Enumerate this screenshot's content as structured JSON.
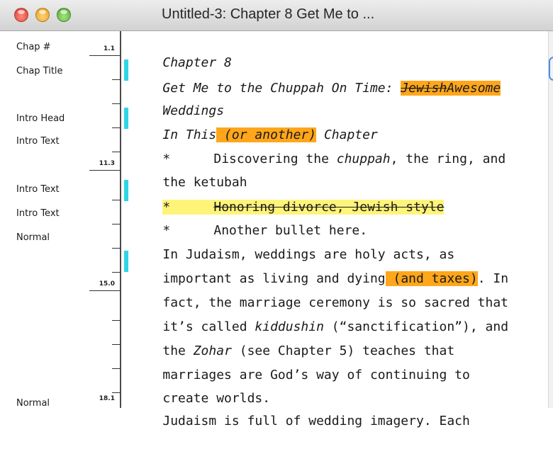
{
  "window": {
    "title": "Untitled-3: Chapter 8 Get Me to ..."
  },
  "sidebar": {
    "labels": [
      "Chap #",
      "Chap Title",
      "Intro Head",
      "Intro Text",
      "Intro Text",
      "Intro Text",
      "Normal",
      "Normal"
    ],
    "depths": [
      "1.1",
      "11.3",
      "15.0",
      "18.1"
    ]
  },
  "document": {
    "chapter_number": "Chapter 8",
    "title_line1_before": "Get Me to the Chuppah On Time: ",
    "title_deleted": "Jewish",
    "title_inserted": "Awesome",
    "title_line2": "Weddings",
    "intro_head_before": "In This",
    "intro_head_inserted": " (or another)",
    "intro_head_after": " Chapter",
    "bullet": "*",
    "bullet1_a": "Discovering the ",
    "bullet1_it": "chuppah",
    "bullet1_b": ", the ring, and",
    "bullet1_line2": "the ketubah",
    "bullet2_deleted": "Honoring divorce, Jewish style",
    "bullet3": "Another bullet here.",
    "para1_line1": "In Judaism, weddings are holy acts, as",
    "para1_line2_a": "important as living and dying",
    "para1_line2_inserted": " (and taxes)",
    "para1_line2_b": ". In",
    "para1_line3": "fact, the marriage ceremony is so sacred that",
    "para1_line4_a": "it’s called ",
    "para1_line4_it": "kiddushin",
    "para1_line4_b": " (“sanctification”), and",
    "para1_line5_a": "the ",
    "para1_line5_it": "Zohar",
    "para1_line5_b": " (see Chapter 5) teaches that",
    "para1_line6": "marriages are God’s way of continuing to",
    "para1_line7": "create worlds.",
    "para2_line1": "Judaism is full of wedding imagery. Each"
  },
  "colors": {
    "insert_highlight": "#ffa61a",
    "delete_highlight": "#fff47a",
    "change_bar": "#2ed6e6"
  }
}
